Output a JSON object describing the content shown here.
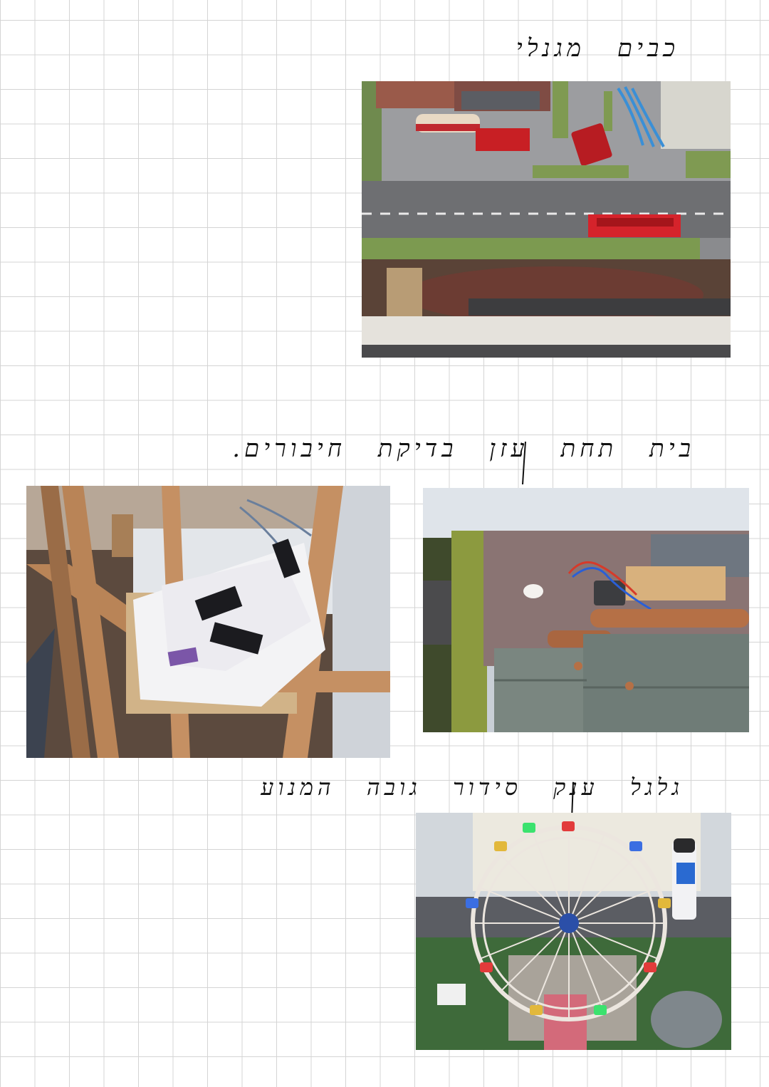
{
  "notes": {
    "first": "כבים מגנלי",
    "second": "בית תחת עזן בדיקת חיבורים.",
    "third": "גלגל ענק סידור גובה המנוע"
  },
  "colors": {
    "paper": "#ffffff",
    "grid": "#d4d4d4",
    "ink": "#111111"
  }
}
